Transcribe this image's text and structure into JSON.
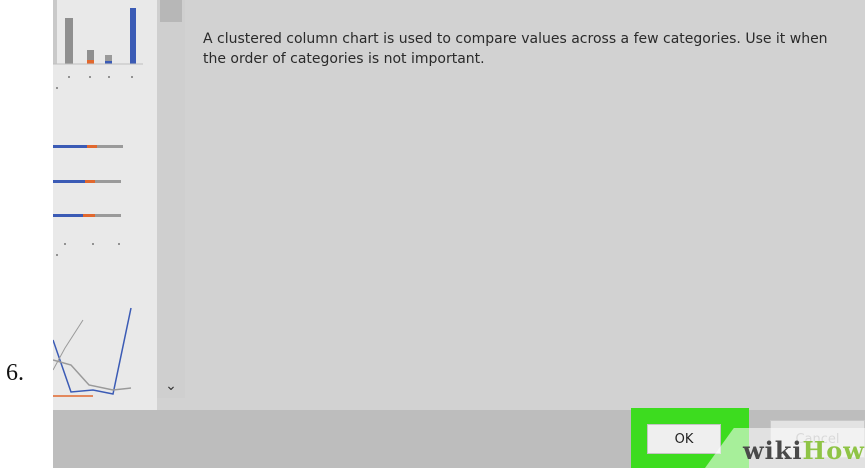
{
  "step_number": "6.",
  "dialog": {
    "description": "A clustered column chart is used to compare values across a few categories. Use it when the order of categories is not important.",
    "ok_label": "OK",
    "cancel_label": "Cancel"
  },
  "watermark": {
    "part1": "wiki",
    "part2": "How"
  },
  "colors": {
    "highlight": "#3ddc1f",
    "series_blue": "#3b5bb5",
    "series_orange": "#e1682e",
    "series_gray": "#9a9a9a"
  },
  "icons": [
    "chevron-down-icon"
  ]
}
